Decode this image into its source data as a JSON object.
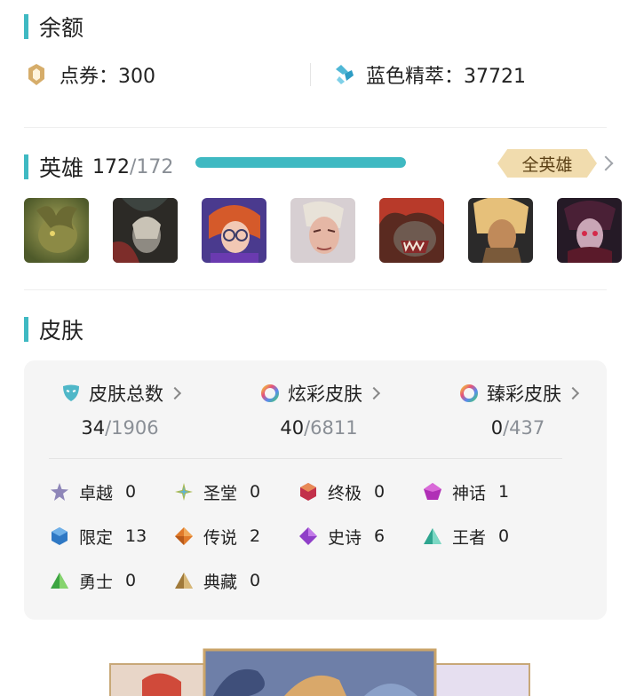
{
  "balance": {
    "title": "余额",
    "points_label": "点券：300",
    "essence_label": "蓝色精萃：37721"
  },
  "heroes": {
    "title": "英雄",
    "owned": "172",
    "total": "/172",
    "progress": 1.0,
    "all_button": "全英雄",
    "avatars": [
      "hero-1",
      "hero-2",
      "hero-3",
      "hero-4",
      "hero-5",
      "hero-6",
      "hero-7"
    ]
  },
  "skins": {
    "title": "皮肤",
    "stats": [
      {
        "label": "皮肤总数",
        "owned": "34",
        "total": "/1906",
        "icon": "mask-icon"
      },
      {
        "label": "炫彩皮肤",
        "owned": "40",
        "total": "/6811",
        "icon": "chroma-ring-icon"
      },
      {
        "label": "臻彩皮肤",
        "owned": "0",
        "total": "/437",
        "icon": "prestige-ring-icon"
      }
    ],
    "tiers": [
      {
        "label": "卓越",
        "count": "0",
        "color": "#8e86b8"
      },
      {
        "label": "圣堂",
        "count": "0",
        "color": "#a8b94f"
      },
      {
        "label": "终极",
        "count": "0",
        "color": "#c2304a"
      },
      {
        "label": "神话",
        "count": "1",
        "color": "#b02fb6"
      },
      {
        "label": "限定",
        "count": "13",
        "color": "#2f78c4"
      },
      {
        "label": "传说",
        "count": "2",
        "color": "#e07a2a"
      },
      {
        "label": "史诗",
        "count": "6",
        "color": "#8f3fc8"
      },
      {
        "label": "王者",
        "count": "0",
        "color": "#2ea58f"
      },
      {
        "label": "勇士",
        "count": "0",
        "color": "#3da542"
      },
      {
        "label": "典藏",
        "count": "0",
        "color": "#a07a3a"
      }
    ]
  },
  "colors": {
    "accent": "#3fb9c2",
    "badge": "#f1dcae"
  }
}
